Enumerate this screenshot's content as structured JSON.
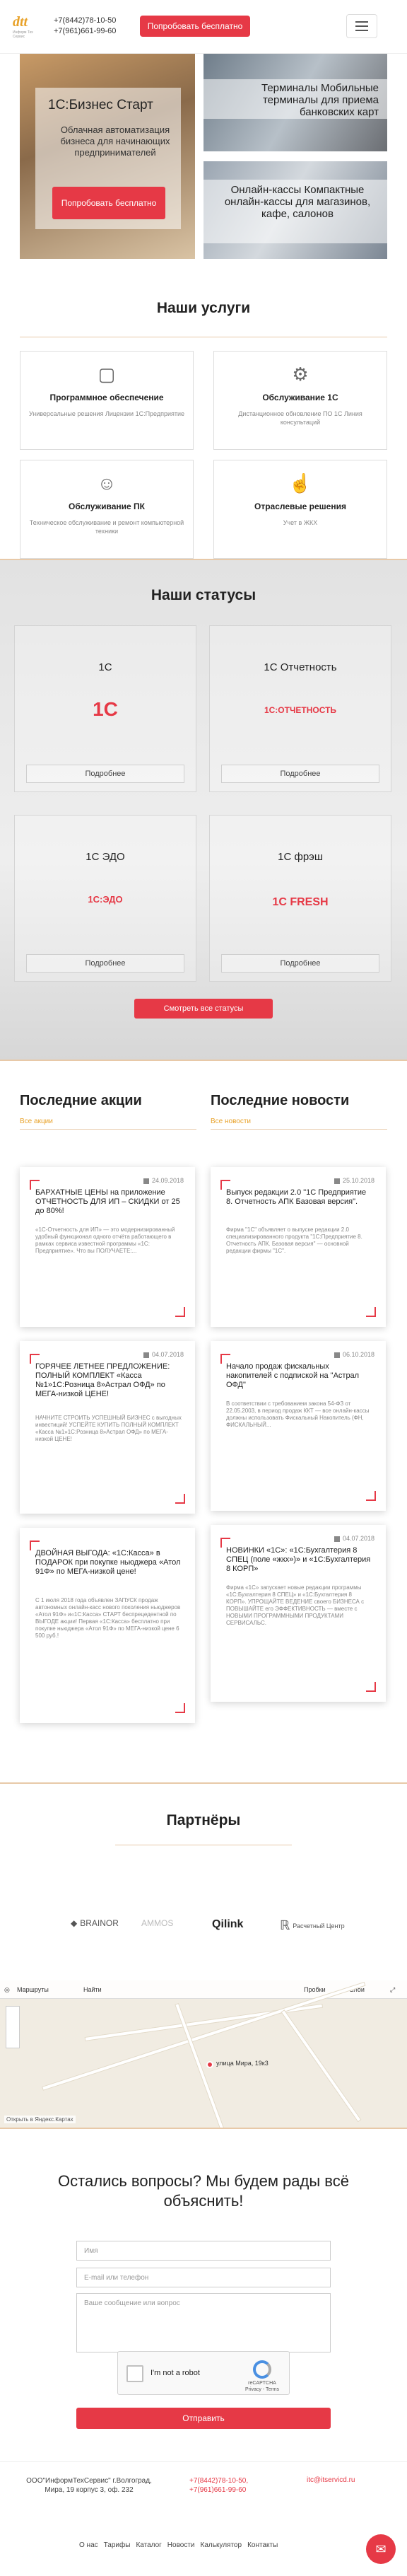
{
  "header": {
    "logo_mark": "dtt",
    "logo_tag": "Информ Тех Сервис",
    "phone1": "+7(8442)78-10-50",
    "phone2": "+7(961)661-99-60",
    "try_button": "Попробовать бесплатно"
  },
  "hero": {
    "main_title": "1С:Бизнес Старт",
    "main_text": "Облачная автоматизация бизнеса для начинающих предпринимателей",
    "main_button": "Попробовать бесплатно",
    "card1_text": "Терминалы Мобильные терминалы для приема банковских карт",
    "card2_text": "Онлайн-кассы Компактные онлайн-кассы для магазинов, кафе, салонов"
  },
  "services": {
    "title": "Наши услуги",
    "items": [
      {
        "title": "Программное обеспечение",
        "text": "Универсальные решения Лицензии 1С:Предприятие"
      },
      {
        "title": "Обслуживание 1С",
        "text": "Дистанционное обновление ПО 1С Линия консультаций"
      },
      {
        "title": "Обслуживание ПК",
        "text": "Техническое обслуживание и ремонт компьютерной техники"
      },
      {
        "title": "Отраслевые решения",
        "text": "Учет в ЖКХ"
      }
    ]
  },
  "statuses": {
    "title": "Наши статусы",
    "items": [
      {
        "name": "1С",
        "brand": "1С",
        "more": "Подробнее"
      },
      {
        "name": "1С Отчетность",
        "brand": "1С:ОТЧЕТНОСТЬ",
        "more": "Подробнее"
      },
      {
        "name": "1С ЭДО",
        "brand": "1С:ЭДО",
        "more": "Подробнее"
      },
      {
        "name": "1С фрэш",
        "brand": "1С FRESH",
        "more": "Подробнее"
      }
    ],
    "all_button": "Смотреть все статусы"
  },
  "promos": {
    "title": "Последние акции",
    "link": "Все акции",
    "items": [
      {
        "date": "24.09.2018",
        "title": "БАРХАТНЫЕ ЦЕНЫ на приложение ОТЧЕТНОСТЬ ДЛЯ ИП – СКИДКИ от 25 до 80%!",
        "text": "«1С-Отчетность для ИП» — это модернизированный удобный функционал одного отчёта работающего в рамках сервиса известной программы «1С: Предприятие». Что вы ПОЛУЧАЕТЕ:..."
      },
      {
        "date": "04.07.2018",
        "title": "ГОРЯЧЕЕ ЛЕТНЕЕ ПРЕДЛОЖЕНИЕ: ПОЛНЫЙ КОМПЛЕКТ «Касса №1»1С:Розница 8»Астрал ОФД» по МЕГА-низкой ЦЕНЕ!",
        "text": "НАЧНИТЕ СТРОИТЬ УСПЕШНЫЙ БИЗНЕС с выгодных инвестиций! УСПЕЙТЕ КУПИТЬ ПОЛНЫЙ КОМПЛЕКТ «Касса №1»1С:Розница 8»Астрал ОФД» по МЕГА-низкой ЦЕНЕ!"
      },
      {
        "date": "",
        "title": "ДВОЙНАЯ ВЫГОДА: «1С:Касса» в ПОДАРОК при покупке ньюджера «Атол 91Ф» по МЕГА-низкой цене!",
        "text": "С 1 июля 2018 года объявлен ЗАПУСК продаж автономных онлайн-касс нового поколения ньюджеров «Атол 91Ф» и«1С:Касса» СТАРТ беспрецедентной по ВЫГОДЕ акции! Первая «1С:Касса» бесплатно при покупке ньюджера «Атол 91Ф» по МЕГА-низкой цене 6 500 руб.!"
      }
    ]
  },
  "news": {
    "title": "Последние новости",
    "link": "Все новости",
    "items": [
      {
        "date": "25.10.2018",
        "title": "Выпуск редакции 2.0 \"1С Предприятие 8. Отчетность АПК Базовая версия\".",
        "text": "Фирма \"1С\" объявляет о выпуске редакции 2.0 специализированного продукта \"1С:Предприятие 8. Отчетность АПК. Базовая версия\" — основной редакции фирмы \"1С\"."
      },
      {
        "date": "06.10.2018",
        "title": "Начало продаж фискальных накопителей с подпиской на \"Астрал ОФД\"",
        "text": "В соответствии с требованием закона 54-ФЗ от 22.05.2003, в период продаж ККТ — все онлайн-кассы должны использовать Фискальный Накопитель (ФН, ФИСКАЛЬНЫЙ..."
      },
      {
        "date": "04.07.2018",
        "title": "НОВИНКИ «1С»: «1С:Бухгалтерия 8 СПЕЦ (поле «жкх»)» и «1С:Бухгалтерия 8 КОРП»",
        "text": "Фирма «1С» запускает новые редакции программы «1С:Бухгалтерия 8 СПЕЦ» и «1С:Бухгалтерия 8 КОРП». УПРОЩАЙТЕ ВЕДЕНИЕ своего БИЗНЕСА с ПОВЫШАЙТЕ его ЭФФЕКТИВНОСТЬ — вместе с НОВЫМИ ПРОГРАММНЫМИ ПРОДУКТАМИ СЕРВИСАЛЬС."
      }
    ]
  },
  "partners": {
    "title": "Партнёры",
    "items": [
      "BRAINOR",
      "AMMOS",
      "Qilink",
      "Расчетный Центр"
    ]
  },
  "map": {
    "route_label": "Маршруты",
    "find_label": "Найти",
    "traffic_label": "Пробки",
    "layers_label": "Слои",
    "address_label": "улица Мира, 19к3",
    "open_label": "Открыть в Яндекс.Картах"
  },
  "contact": {
    "title": "Остались вопросы? Мы будем рады всё объяснить!",
    "name_placeholder": "Имя",
    "contact_placeholder": "E-mail или телефон",
    "question_placeholder": "Ваше сообщение или вопрос",
    "captcha_label": "I'm not a robot",
    "captcha_brand": "reCAPTCHA",
    "captcha_terms": "Privacy - Terms",
    "send_button": "Отправить"
  },
  "footer": {
    "address": "ООО\"ИнформТехСервис\" г.Волгоград, Мира, 19 корпус 3, оф. 232",
    "phone1": "+7(8442)78-10-50,",
    "phone2": "+7(961)661-99-60",
    "email": "itc@itservicd.ru",
    "nav": [
      "О нас",
      "Тарифы",
      "Каталог",
      "Новости",
      "Калькулятор",
      "Контакты"
    ]
  },
  "colors": {
    "accent": "#e63946",
    "gold": "#e8a22a",
    "divider": "#e8c9a8"
  }
}
